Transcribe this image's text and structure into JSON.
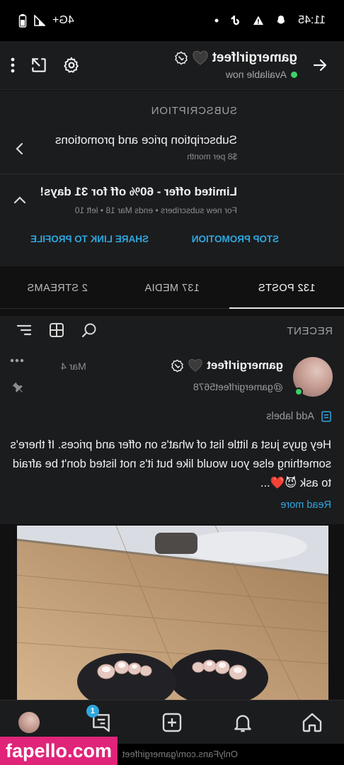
{
  "status_bar": {
    "time": "11:45",
    "network": "4G+"
  },
  "top_bar": {
    "name": "gamergirlfeet",
    "status": "Available now"
  },
  "subscription": {
    "heading": "SUBSCRIPTION",
    "price_title": "Subscription price and promotions",
    "price_sub": "$8 per month",
    "offer_title": "Limited offer - 60% off for 31 days!",
    "offer_sub": "For new subscribers  •  ends Mar 18  •  left 10",
    "stop_label": "STOP PROMOTION",
    "share_label": "SHARE LINK TO PROFILE"
  },
  "tabs": [
    {
      "label": "132 POSTS"
    },
    {
      "label": "137 MEDIA"
    },
    {
      "label": "2 STREAMS"
    }
  ],
  "recent": {
    "label": "RECENT"
  },
  "post": {
    "name": "gamergirlfeet",
    "handle": "@gamergirlfeet5678",
    "date": "Mar 4",
    "add_labels": "Add labels",
    "text": "Hey guys just a little list of what's on offer and prices. If there's something else you would like but it's not listed don't be afraid to ask 😈❤️...",
    "read_more": "Read more"
  },
  "media_watermark": "OnlyFans.com/gamergirlfeet",
  "bottom_nav": {
    "messages_badge": "1"
  },
  "overlay": {
    "watermark": "fapello.com"
  },
  "colors": {
    "accent": "#2fa7de",
    "online": "#3dd068",
    "watermark_bg": "#e0247a"
  }
}
